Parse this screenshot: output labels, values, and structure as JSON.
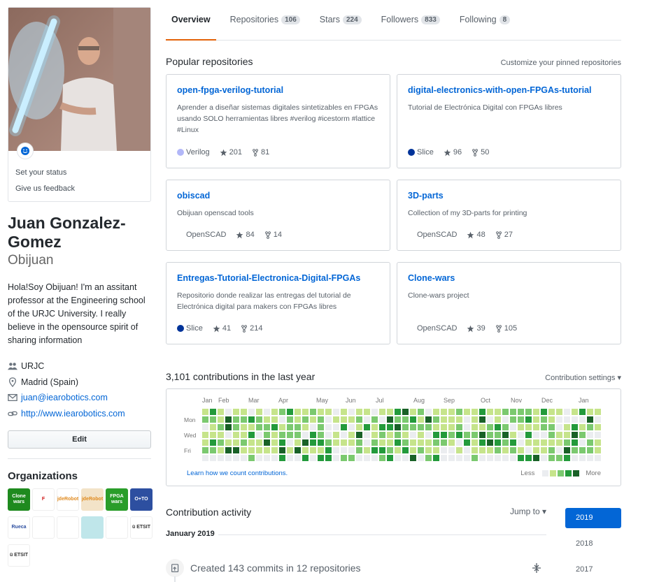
{
  "profile": {
    "status_label": "Set your status",
    "feedback_label": "Give us feedback",
    "full_name": "Juan Gonzalez-Gomez",
    "username": "Obijuan",
    "bio": "Hola!Soy Obijuan! I'm an assitant professor at the Engineering school of the URJC University. I really believe in the opensource spirit of sharing information",
    "company": "URJC",
    "location": "Madrid (Spain)",
    "email": "juan@iearobotics.com",
    "website": "http://www.iearobotics.com",
    "edit_label": "Edit"
  },
  "organizations": {
    "title": "Organizations",
    "items": [
      {
        "name": "clone-wars",
        "text": "Clone wars",
        "bg": "#1e8a1e",
        "fg": "#ffffff"
      },
      {
        "name": "f-gear",
        "text": "F",
        "bg": "#ffffff",
        "fg": "#d11919"
      },
      {
        "name": "jdefrobot-1",
        "text": "jdeRobot",
        "bg": "#ffffff",
        "fg": "#e08a1e"
      },
      {
        "name": "jdefrobot-2",
        "text": "jdeRobot",
        "bg": "#f3e3c8",
        "fg": "#e08a1e"
      },
      {
        "name": "fpga-wars",
        "text": "FPGA wars",
        "bg": "#2a9d2a",
        "fg": "#ffffff"
      },
      {
        "name": "otto",
        "text": "O+TO",
        "bg": "#2d4fa0",
        "fg": "#ffffff"
      },
      {
        "name": "rueca",
        "text": "Rueca",
        "bg": "#ffffff",
        "fg": "#2d4fa0"
      },
      {
        "name": "robot-board",
        "text": "",
        "bg": "#ffffff",
        "fg": "#555555"
      },
      {
        "name": "sketch",
        "text": "",
        "bg": "#ffffff",
        "fg": "#555555"
      },
      {
        "name": "puzzle",
        "text": "",
        "bg": "#bfe6ea",
        "fg": "#ffffff"
      },
      {
        "name": "bqs",
        "text": "",
        "bg": "#ffffff",
        "fg": "#333333"
      },
      {
        "name": "etsit-1",
        "text": "ü ETSIT",
        "bg": "#ffffff",
        "fg": "#333333"
      },
      {
        "name": "etsit-2",
        "text": "ü ETSIT",
        "bg": "#ffffff",
        "fg": "#333333"
      }
    ]
  },
  "tabs": [
    {
      "label": "Overview",
      "count": "",
      "active": true
    },
    {
      "label": "Repositories",
      "count": "106"
    },
    {
      "label": "Stars",
      "count": "224"
    },
    {
      "label": "Followers",
      "count": "833"
    },
    {
      "label": "Following",
      "count": "8"
    }
  ],
  "popular": {
    "title": "Popular repositories",
    "customize_label": "Customize your pinned repositories",
    "repos": [
      {
        "name": "open-fpga-verilog-tutorial",
        "desc": "Aprender a diseñar sistemas digitales sintetizables en FPGAs usando SOLO herramientas libres #verilog #icestorm #lattice #Linux",
        "lang": "Verilog",
        "lang_color": "#b2b7f8",
        "stars": "201",
        "forks": "81"
      },
      {
        "name": "digital-electronics-with-open-FPGAs-tutorial",
        "desc": "Tutorial de Electrónica Digital con FPGAs libres",
        "lang": "Slice",
        "lang_color": "#003399",
        "stars": "96",
        "forks": "50"
      },
      {
        "name": "obiscad",
        "desc": "Obijuan openscad tools",
        "lang": "OpenSCAD",
        "lang_color": "",
        "stars": "84",
        "forks": "14"
      },
      {
        "name": "3D-parts",
        "desc": "Collection of my 3D-parts for printing",
        "lang": "OpenSCAD",
        "lang_color": "",
        "stars": "48",
        "forks": "27"
      },
      {
        "name": "Entregas-Tutorial-Electronica-Digital-FPGAs",
        "desc": "Repositorio donde realizar las entregas del tutorial de Electrónica digital para makers con FPGAs libres",
        "lang": "Slice",
        "lang_color": "#003399",
        "stars": "41",
        "forks": "214"
      },
      {
        "name": "Clone-wars",
        "desc": "Clone-wars project",
        "lang": "OpenSCAD",
        "lang_color": "",
        "stars": "39",
        "forks": "105"
      }
    ]
  },
  "contributions": {
    "title": "3,101 contributions in the last year",
    "settings_label": "Contribution settings ▾",
    "months": [
      "Jan",
      "Feb",
      "Mar",
      "Apr",
      "May",
      "Jun",
      "Jul",
      "Aug",
      "Sep",
      "Oct",
      "Nov",
      "Dec",
      "Jan"
    ],
    "days": [
      "Mon",
      "Wed",
      "Fri"
    ],
    "learn_label": "Learn how we count contributions.",
    "less_label": "Less",
    "more_label": "More",
    "palette": [
      "#ebedf0",
      "#c6e48b",
      "#7bc96f",
      "#239a3b",
      "#196127"
    ]
  },
  "activity": {
    "title": "Contribution activity",
    "jump_label": "Jump to ▾",
    "month_label": "January 2019",
    "item_text": "Created 143 commits in 12 repositories",
    "years": [
      "2019",
      "2018",
      "2017"
    ]
  }
}
